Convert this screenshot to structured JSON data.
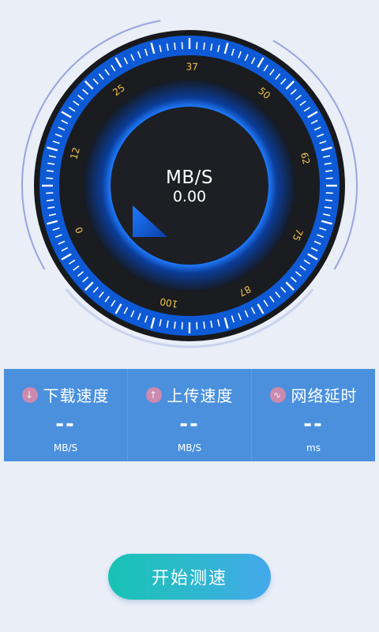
{
  "gauge": {
    "unit": "MB/S",
    "value": "0.00",
    "scale_labels": [
      "0",
      "12",
      "25",
      "37",
      "50",
      "62",
      "75",
      "87",
      "100"
    ]
  },
  "stats": [
    {
      "icon": "download-icon",
      "glyph": "↓",
      "label": "下载速度",
      "value": "--",
      "unit": "MB/S"
    },
    {
      "icon": "upload-icon",
      "glyph": "↑",
      "label": "上传速度",
      "value": "--",
      "unit": "MB/S"
    },
    {
      "icon": "latency-icon",
      "glyph": "∿",
      "label": "网络延时",
      "value": "--",
      "unit": "ms"
    }
  ],
  "start_button": {
    "label": "开始测速"
  },
  "colors": {
    "background": "#e9eef7",
    "accent_blue": "#1e7bff",
    "panel": "#4a90dd",
    "tick_label": "#f3c64a",
    "button_from": "#18c3b4",
    "button_to": "#45a8ec"
  }
}
